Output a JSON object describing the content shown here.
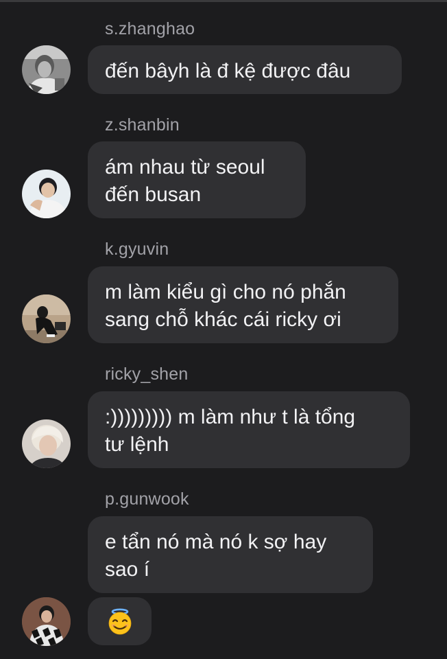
{
  "messages": [
    {
      "sender": "s.zhanghao",
      "text": "đến bâyh là đ kệ được đâu"
    },
    {
      "sender": "z.shanbin",
      "text": "ám nhau từ seoul\nđến busan"
    },
    {
      "sender": "k.gyuvin",
      "text": "m làm kiểu gì cho nó phắn\nsang chỗ khác cái ricky ơi"
    },
    {
      "sender": "ricky_shen",
      "text": ":))))))))) m làm như t là tổng\ntư lệnh"
    },
    {
      "sender": "p.gunwook",
      "text": "e tẩn nó mà nó k sợ hay\nsao í"
    },
    {
      "sender": "",
      "emoji": "smiling-face-with-halo-icon"
    }
  ],
  "colors": {
    "background": "#1c1c1e",
    "bubble": "#303033",
    "sender_text": "#a2a2a8",
    "message_text": "#f2f2f4"
  }
}
